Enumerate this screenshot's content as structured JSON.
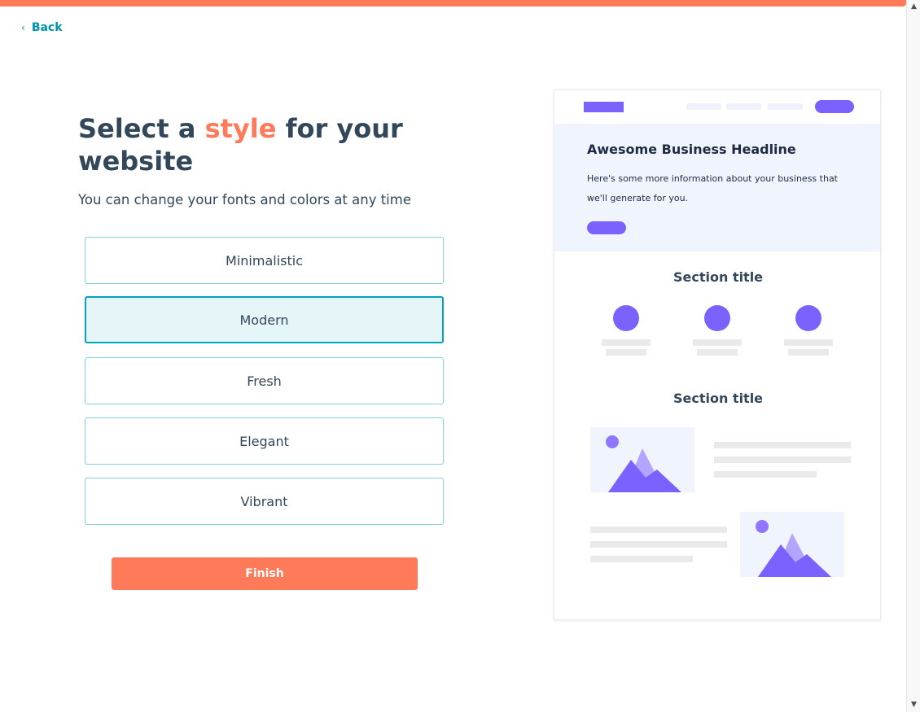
{
  "nav": {
    "back_label": "Back",
    "back_icon": "chevron-left-icon"
  },
  "page": {
    "title_prefix": "Select a ",
    "title_accent": "style",
    "title_suffix": " for your website",
    "subtitle": "You can change your fonts and colors at any time"
  },
  "styles": {
    "options": [
      {
        "label": "Minimalistic",
        "selected": false
      },
      {
        "label": "Modern",
        "selected": true
      },
      {
        "label": "Fresh",
        "selected": false
      },
      {
        "label": "Elegant",
        "selected": false
      },
      {
        "label": "Vibrant",
        "selected": false
      }
    ]
  },
  "finish_label": "Finish",
  "preview": {
    "hero_title": "Awesome Business Headline",
    "hero_text": "Here's some more information about your business that we'll generate for you.",
    "section1_title": "Section title",
    "section2_title": "Section title"
  },
  "colors": {
    "accent": "#ff7a59",
    "link": "#0091ae",
    "selected_border": "#00a4bd",
    "selected_fill": "#e5f5f8",
    "preview_purple": "#7b61ff",
    "text": "#33475b"
  }
}
